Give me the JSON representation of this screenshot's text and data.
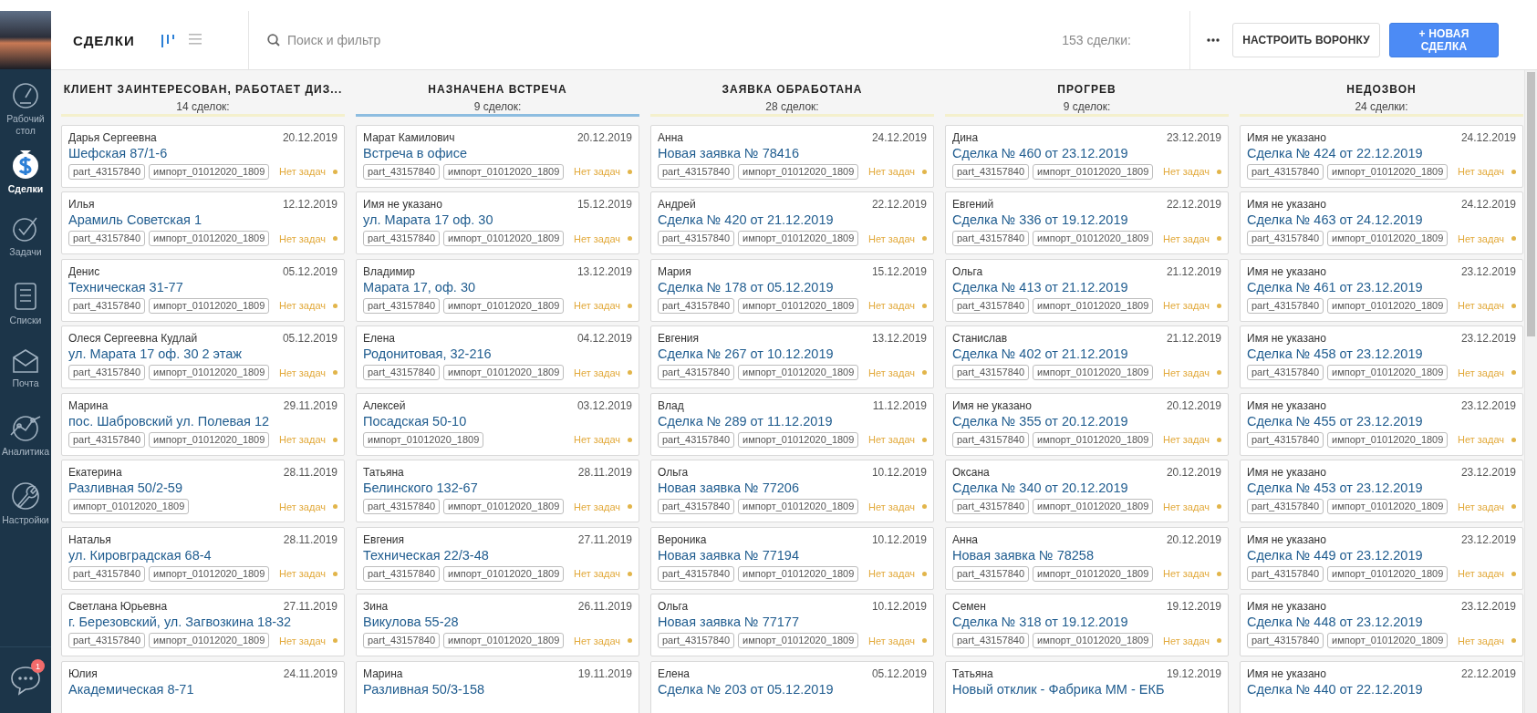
{
  "sidebar": {
    "items": [
      {
        "label": "Рабочий стол",
        "kind": "dashboard",
        "selected": false
      },
      {
        "label": "Сделки",
        "kind": "deals",
        "selected": true
      },
      {
        "label": "Задачи",
        "kind": "tasks",
        "selected": false
      },
      {
        "label": "Списки",
        "kind": "lists",
        "selected": false
      },
      {
        "label": "Почта",
        "kind": "mail",
        "selected": false
      },
      {
        "label": "Аналитика",
        "kind": "analytics",
        "selected": false
      },
      {
        "label": "Настройки",
        "kind": "settings",
        "selected": false
      }
    ],
    "chat": {
      "badge": "1"
    }
  },
  "header": {
    "title": "СДЕЛКИ",
    "views": [
      {
        "kind": "pipeline",
        "selected": true
      },
      {
        "kind": "list",
        "selected": false
      }
    ],
    "search": {
      "placeholder": "Поиск и фильтр"
    },
    "count": "153 сделки:",
    "buttons": [
      {
        "label": "НАСТРОИТЬ ВОРОНКУ",
        "kind": "secondary"
      },
      {
        "label": "+ НОВАЯ СДЕЛКА",
        "kind": "primary"
      }
    ]
  },
  "columns": [
    {
      "title": "КЛИЕНТ ЗАИНТЕРЕСОВАН, РАБОТАЕТ ДИЗ...",
      "count": "14 сделок:",
      "color": "#f4f0cc",
      "cards": [
        {
          "name": "Дарья Сергеевна",
          "date": "20.12.2019",
          "title": "Шефская 87/1-6",
          "tags": [
            "part_43157840",
            "импорт_01012020_1809"
          ],
          "tasks": "Нет задач"
        },
        {
          "name": "Илья",
          "date": "12.12.2019",
          "title": "Арамиль Советская 1",
          "tags": [
            "part_43157840",
            "импорт_01012020_1809"
          ],
          "tasks": "Нет задач"
        },
        {
          "name": "Денис",
          "date": "05.12.2019",
          "title": "Техническая 31-77",
          "tags": [
            "part_43157840",
            "импорт_01012020_1809"
          ],
          "tasks": "Нет задач"
        },
        {
          "name": "Олеся Сергеевна Кудлай",
          "date": "05.12.2019",
          "title": "ул. Марата 17 оф. 30 2 этаж",
          "tags": [
            "part_43157840",
            "импорт_01012020_1809"
          ],
          "tasks": "Нет задач"
        },
        {
          "name": "Марина",
          "date": "29.11.2019",
          "title": "пос. Шабровский ул. Полевая 12",
          "tags": [
            "part_43157840",
            "импорт_01012020_1809"
          ],
          "tasks": "Нет задач"
        },
        {
          "name": "Екатерина",
          "date": "28.11.2019",
          "title": "Разливная 50/2-59",
          "tags": [
            "импорт_01012020_1809"
          ],
          "tasks": "Нет задач"
        },
        {
          "name": "Наталья",
          "date": "28.11.2019",
          "title": "ул. Кировградская 68-4",
          "tags": [
            "part_43157840",
            "импорт_01012020_1809"
          ],
          "tasks": "Нет задач"
        },
        {
          "name": "Светлана Юрьевна",
          "date": "27.11.2019",
          "title": "г. Березовский, ул. Загвозкина 18-32",
          "tags": [
            "part_43157840",
            "импорт_01012020_1809"
          ],
          "tasks": "Нет задач"
        },
        {
          "name": "Юлия",
          "date": "24.11.2019",
          "title": "Академическая 8-71"
        }
      ]
    },
    {
      "title": "НАЗНАЧЕНА ВСТРЕЧА",
      "count": "9 сделок:",
      "color": "#8dbde0",
      "cards": [
        {
          "name": "Марат Камилович",
          "date": "20.12.2019",
          "title": "Встреча в офисе",
          "tags": [
            "part_43157840",
            "импорт_01012020_1809"
          ],
          "tasks": "Нет задач"
        },
        {
          "name": "Имя не указано",
          "date": "15.12.2019",
          "title": "ул. Марата 17 оф. 30",
          "tags": [
            "part_43157840",
            "импорт_01012020_1809"
          ],
          "tasks": "Нет задач"
        },
        {
          "name": "Владимир",
          "date": "13.12.2019",
          "title": "Марата 17, оф. 30",
          "tags": [
            "part_43157840",
            "импорт_01012020_1809"
          ],
          "tasks": "Нет задач"
        },
        {
          "name": "Елена",
          "date": "04.12.2019",
          "title": "Родонитовая, 32-216",
          "tags": [
            "part_43157840",
            "импорт_01012020_1809"
          ],
          "tasks": "Нет задач"
        },
        {
          "name": "Алексей",
          "date": "03.12.2019",
          "title": "Посадская 50-10",
          "tags": [
            "импорт_01012020_1809"
          ],
          "tasks": "Нет задач"
        },
        {
          "name": "Татьяна",
          "date": "28.11.2019",
          "title": "Белинского 132-67",
          "tags": [
            "part_43157840",
            "импорт_01012020_1809"
          ],
          "tasks": "Нет задач"
        },
        {
          "name": "Евгения",
          "date": "27.11.2019",
          "title": "Техническая 22/3-48",
          "tags": [
            "part_43157840",
            "импорт_01012020_1809"
          ],
          "tasks": "Нет задач"
        },
        {
          "name": "Зина",
          "date": "26.11.2019",
          "title": "Викулова 55-28",
          "tags": [
            "part_43157840",
            "импорт_01012020_1809"
          ],
          "tasks": "Нет задач"
        },
        {
          "name": "Марина",
          "date": "19.11.2019",
          "title": "Разливная 50/3-158"
        }
      ]
    },
    {
      "title": "ЗАЯВКА ОБРАБОТАНА",
      "count": "28 сделок:",
      "color": "#f4f0cc",
      "cards": [
        {
          "name": "Анна",
          "date": "24.12.2019",
          "title": "Новая заявка № 78416",
          "tags": [
            "part_43157840",
            "импорт_01012020_1809"
          ],
          "tasks": "Нет задач"
        },
        {
          "name": "Андрей",
          "date": "22.12.2019",
          "title": "Сделка № 420 от 21.12.2019",
          "tags": [
            "part_43157840",
            "импорт_01012020_1809"
          ],
          "tasks": "Нет задач"
        },
        {
          "name": "Мария",
          "date": "15.12.2019",
          "title": "Сделка № 178 от 05.12.2019",
          "tags": [
            "part_43157840",
            "импорт_01012020_1809"
          ],
          "tasks": "Нет задач"
        },
        {
          "name": "Евгения",
          "date": "13.12.2019",
          "title": "Сделка № 267 от 10.12.2019",
          "tags": [
            "part_43157840",
            "импорт_01012020_1809"
          ],
          "tasks": "Нет задач"
        },
        {
          "name": "Влад",
          "date": "11.12.2019",
          "title": "Сделка № 289 от 11.12.2019",
          "tags": [
            "part_43157840",
            "импорт_01012020_1809"
          ],
          "tasks": "Нет задач"
        },
        {
          "name": "Ольга",
          "date": "10.12.2019",
          "title": "Новая заявка № 77206",
          "tags": [
            "part_43157840",
            "импорт_01012020_1809"
          ],
          "tasks": "Нет задач"
        },
        {
          "name": "Вероника",
          "date": "10.12.2019",
          "title": "Новая заявка № 77194",
          "tags": [
            "part_43157840",
            "импорт_01012020_1809"
          ],
          "tasks": "Нет задач"
        },
        {
          "name": "Ольга",
          "date": "10.12.2019",
          "title": "Новая заявка № 77177",
          "tags": [
            "part_43157840",
            "импорт_01012020_1809"
          ],
          "tasks": "Нет задач"
        },
        {
          "name": "Елена",
          "date": "05.12.2019",
          "title": "Сделка № 203 от 05.12.2019"
        }
      ]
    },
    {
      "title": "ПРОГРЕВ",
      "count": "9 сделок:",
      "color": "#f4f0cc",
      "cards": [
        {
          "name": "Дина",
          "date": "23.12.2019",
          "title": "Сделка № 460 от 23.12.2019",
          "tags": [
            "part_43157840",
            "импорт_01012020_1809"
          ],
          "tasks": "Нет задач"
        },
        {
          "name": "Евгений",
          "date": "22.12.2019",
          "title": "Сделка № 336 от 19.12.2019",
          "tags": [
            "part_43157840",
            "импорт_01012020_1809"
          ],
          "tasks": "Нет задач"
        },
        {
          "name": "Ольга",
          "date": "21.12.2019",
          "title": "Сделка № 413 от 21.12.2019",
          "tags": [
            "part_43157840",
            "импорт_01012020_1809"
          ],
          "tasks": "Нет задач"
        },
        {
          "name": "Станислав",
          "date": "21.12.2019",
          "title": "Сделка № 402 от 21.12.2019",
          "tags": [
            "part_43157840",
            "импорт_01012020_1809"
          ],
          "tasks": "Нет задач"
        },
        {
          "name": "Имя не указано",
          "date": "20.12.2019",
          "title": "Сделка № 355 от 20.12.2019",
          "tags": [
            "part_43157840",
            "импорт_01012020_1809"
          ],
          "tasks": "Нет задач"
        },
        {
          "name": "Оксана",
          "date": "20.12.2019",
          "title": "Сделка № 340 от 20.12.2019",
          "tags": [
            "part_43157840",
            "импорт_01012020_1809"
          ],
          "tasks": "Нет задач"
        },
        {
          "name": "Анна",
          "date": "20.12.2019",
          "title": "Новая заявка № 78258",
          "tags": [
            "part_43157840",
            "импорт_01012020_1809"
          ],
          "tasks": "Нет задач"
        },
        {
          "name": "Семен",
          "date": "19.12.2019",
          "title": "Сделка № 318 от 19.12.2019",
          "tags": [
            "part_43157840",
            "импорт_01012020_1809"
          ],
          "tasks": "Нет задач"
        },
        {
          "name": "Татьяна",
          "date": "19.12.2019",
          "title": "Новый отклик - Фабрика ММ - ЕКБ"
        }
      ]
    },
    {
      "title": "НЕДОЗВОН",
      "count": "24 сделки:",
      "color": "#f4f0cc",
      "cards": [
        {
          "name": "Имя не указано",
          "date": "24.12.2019",
          "title": "Сделка № 424 от 22.12.2019",
          "tags": [
            "part_43157840",
            "импорт_01012020_1809"
          ],
          "tasks": "Нет задач"
        },
        {
          "name": "Имя не указано",
          "date": "24.12.2019",
          "title": "Сделка № 463 от 24.12.2019",
          "tags": [
            "part_43157840",
            "импорт_01012020_1809"
          ],
          "tasks": "Нет задач"
        },
        {
          "name": "Имя не указано",
          "date": "23.12.2019",
          "title": "Сделка № 461 от 23.12.2019",
          "tags": [
            "part_43157840",
            "импорт_01012020_1809"
          ],
          "tasks": "Нет задач"
        },
        {
          "name": "Имя не указано",
          "date": "23.12.2019",
          "title": "Сделка № 458 от 23.12.2019",
          "tags": [
            "part_43157840",
            "импорт_01012020_1809"
          ],
          "tasks": "Нет задач"
        },
        {
          "name": "Имя не указано",
          "date": "23.12.2019",
          "title": "Сделка № 455 от 23.12.2019",
          "tags": [
            "part_43157840",
            "импорт_01012020_1809"
          ],
          "tasks": "Нет задач"
        },
        {
          "name": "Имя не указано",
          "date": "23.12.2019",
          "title": "Сделка № 453 от 23.12.2019",
          "tags": [
            "part_43157840",
            "импорт_01012020_1809"
          ],
          "tasks": "Нет задач"
        },
        {
          "name": "Имя не указано",
          "date": "23.12.2019",
          "title": "Сделка № 449 от 23.12.2019",
          "tags": [
            "part_43157840",
            "импорт_01012020_1809"
          ],
          "tasks": "Нет задач"
        },
        {
          "name": "Имя не указано",
          "date": "23.12.2019",
          "title": "Сделка № 448 от 23.12.2019",
          "tags": [
            "part_43157840",
            "импорт_01012020_1809"
          ],
          "tasks": "Нет задач"
        },
        {
          "name": "Имя не указано",
          "date": "22.12.2019",
          "title": "Сделка № 440 от 22.12.2019"
        }
      ]
    }
  ]
}
